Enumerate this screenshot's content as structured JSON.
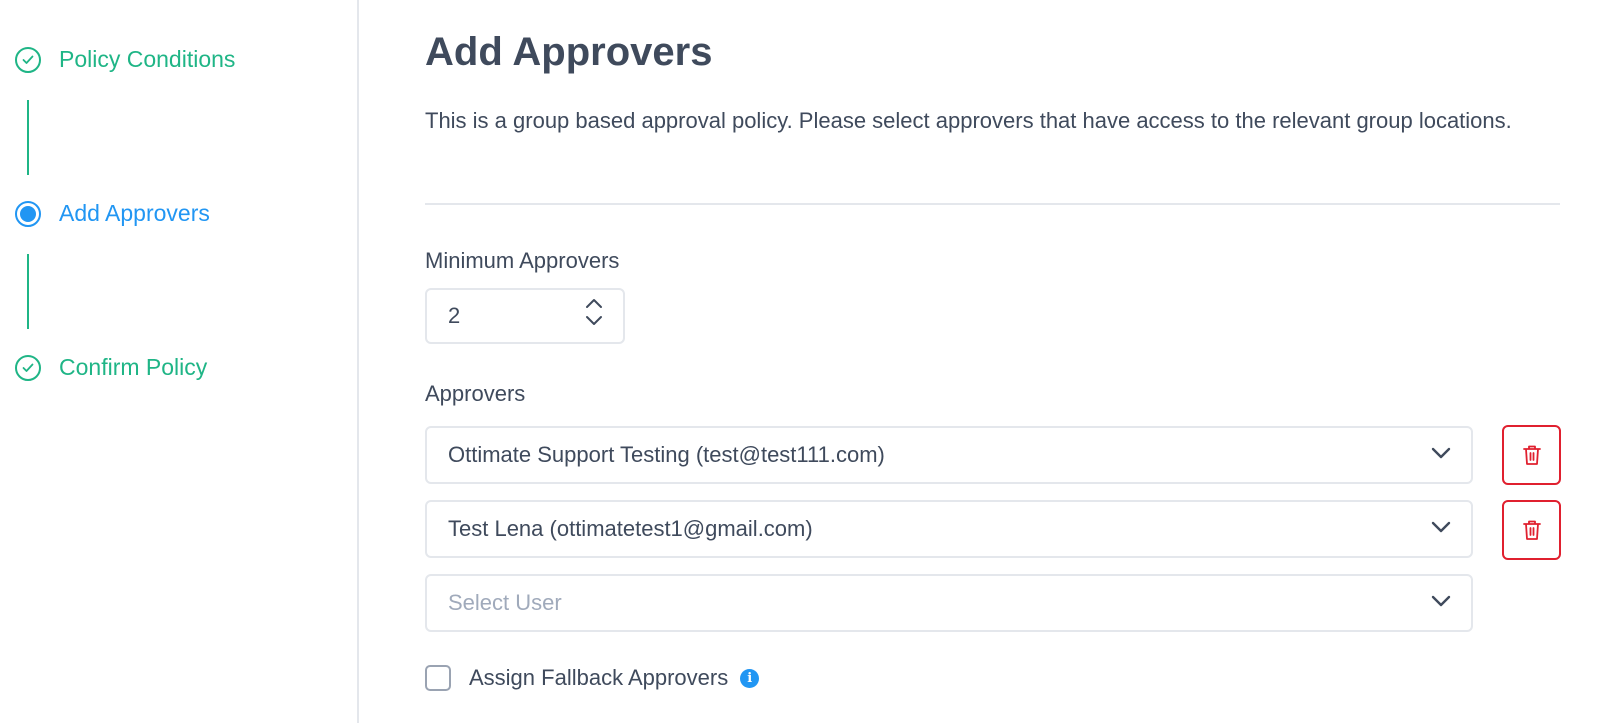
{
  "steps": [
    {
      "label": "Policy Conditions",
      "status": "done"
    },
    {
      "label": "Add Approvers",
      "status": "active"
    },
    {
      "label": "Confirm Policy",
      "status": "done"
    }
  ],
  "main": {
    "title": "Add Approvers",
    "description": "This is a group based approval policy. Please select approvers that have access to the relevant group locations.",
    "min_approvers_label": "Minimum Approvers",
    "min_approvers_value": "2",
    "approvers_label": "Approvers",
    "approvers": [
      "Ottimate Support Testing (test@test111.com)",
      "Test Lena (ottimatetest1@gmail.com)"
    ],
    "select_placeholder": "Select User",
    "fallback_label": "Assign Fallback Approvers",
    "fallback_checked": false
  },
  "colors": {
    "done": "#1fb586",
    "active": "#2196f3",
    "delete": "#e0202f",
    "text": "#3f4a5c",
    "placeholder": "#a0aabb"
  },
  "icons": {
    "done_step": "check-circle-icon",
    "active_step": "radio-dot-icon",
    "stepper": [
      "chevron-up-icon",
      "chevron-down-icon"
    ],
    "dropdown": "chevron-down-icon",
    "delete": "trash-icon",
    "info": "info-icon"
  }
}
